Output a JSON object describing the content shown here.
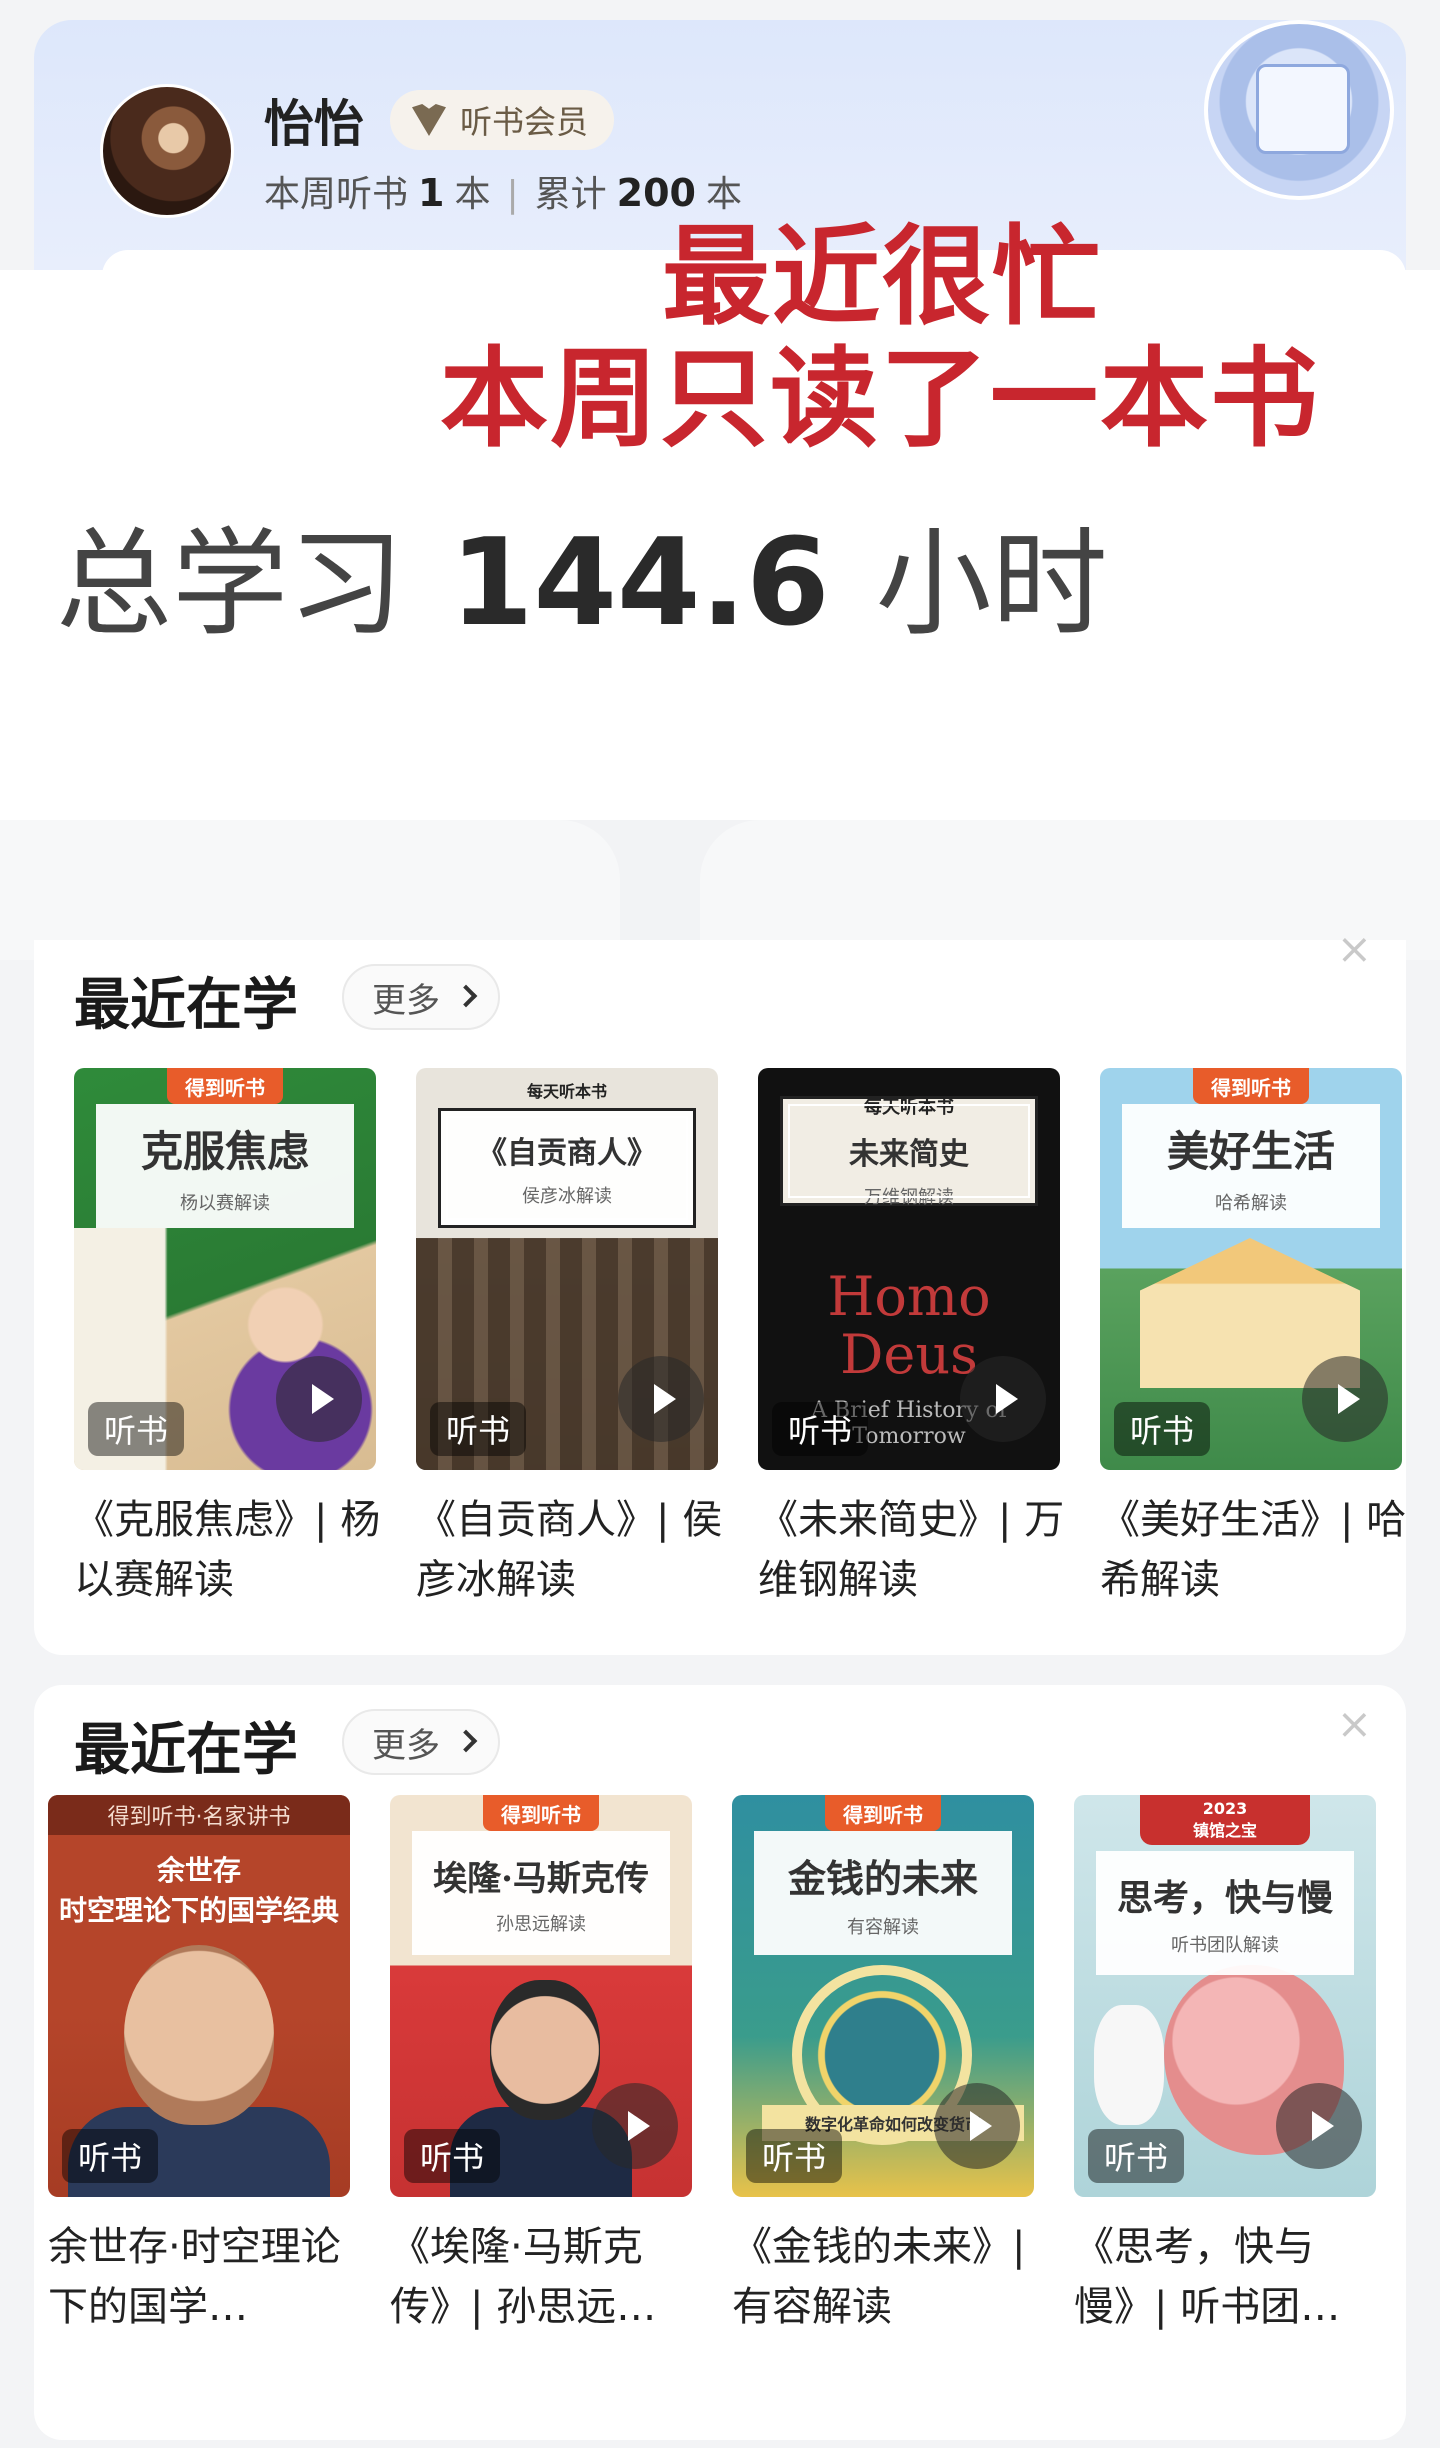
{
  "profile": {
    "name": "怡怡",
    "badge": "听书会员",
    "stats": {
      "weekly_label": "本周听书",
      "weekly_count": "1",
      "unit": "本",
      "separator": "|",
      "total_label": "累计",
      "total_count": "200"
    }
  },
  "annotation": {
    "line1": "最近很忙",
    "line2": "本周只读了一本书"
  },
  "study_total": {
    "prefix": "总学习",
    "value": "144.6",
    "unit": "小时"
  },
  "sections": [
    {
      "title": "最近在学",
      "more_label": "更多",
      "close": "×",
      "books": [
        {
          "cover_brand": "得到听书",
          "cover_title": "克服焦虑",
          "cover_sub": "杨以赛解读",
          "tag": "听书",
          "title": "《克服焦虑》| 杨以赛解读"
        },
        {
          "cover_brand": "每天听本书",
          "cover_title": "《自贡商人》",
          "cover_sub": "侯彦冰解读",
          "tag": "听书",
          "title": "《自贡商人》| 侯彦冰解读"
        },
        {
          "cover_brand": "每天听本书",
          "cover_title": "未来简史",
          "cover_sub": "万维钢解读",
          "cover_art_title": "Homo Deus",
          "cover_art_sub": "A Brief History of Tomorrow",
          "tag": "听书",
          "title": "《未来简史》| 万维钢解读"
        },
        {
          "cover_brand": "得到听书",
          "cover_title": "美好生活",
          "cover_sub": "哈希解读",
          "tag": "听书",
          "title": "《美好生活》| 哈希解读"
        }
      ]
    },
    {
      "title": "最近在学",
      "more_label": "更多",
      "close": "×",
      "books": [
        {
          "cover_brand": "得到听书·名家讲书",
          "cover_headline_1": "余世存",
          "cover_headline_2": "时空理论下的国学经典",
          "tag": "听书",
          "title": "余世存·时空理论下的国学…"
        },
        {
          "cover_brand": "得到听书",
          "cover_title": "埃隆·马斯克传",
          "cover_sub": "孙思远解读",
          "tag": "听书",
          "title": "《埃隆·马斯克传》| 孙思远…"
        },
        {
          "cover_brand": "得到听书",
          "cover_title": "金钱的未来",
          "cover_sub": "有容解读",
          "cover_ribbon": "数字化革命如何改变货币",
          "tag": "听书",
          "title": "《金钱的未来》| 有容解读"
        },
        {
          "cover_award_year": "2023",
          "cover_award": "镇馆之宝",
          "cover_title": "思考，快与慢",
          "cover_sub": "听书团队解读",
          "tag": "听书",
          "title": "《思考，快与慢》| 听书团…"
        }
      ]
    }
  ]
}
